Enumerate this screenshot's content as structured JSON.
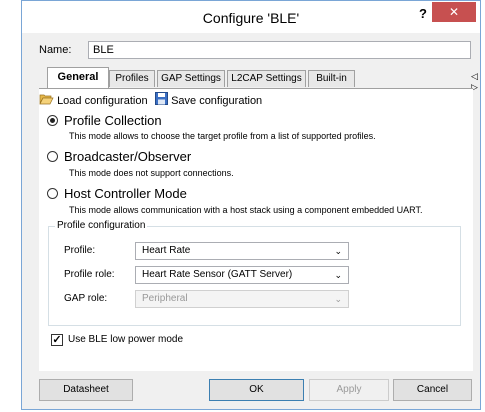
{
  "window": {
    "title": "Configure 'BLE'",
    "help_label": "?",
    "close_label": "✕"
  },
  "name": {
    "label": "Name:",
    "value": "BLE"
  },
  "tabs": [
    {
      "label": "General"
    },
    {
      "label": "Profiles"
    },
    {
      "label": "GAP Settings"
    },
    {
      "label": "L2CAP Settings"
    },
    {
      "label": "Built-in"
    }
  ],
  "tab_scroll": "◁ ▷",
  "toolbar": {
    "load_label": "Load configuration",
    "save_label": "Save configuration"
  },
  "modes": [
    {
      "title": "Profile Collection",
      "description": "This mode allows to choose the target profile from a list of supported profiles.",
      "selected": true
    },
    {
      "title": "Broadcaster/Observer",
      "description": "This mode does not support connections.",
      "selected": false
    },
    {
      "title": "Host Controller Mode",
      "description": "This mode allows communication with a host stack using a component embedded UART.",
      "selected": false
    }
  ],
  "profile_config": {
    "legend": "Profile configuration",
    "profile_label": "Profile:",
    "profile_value": "Heart Rate",
    "role_label": "Profile role:",
    "role_value": "Heart Rate Sensor (GATT Server)",
    "gap_label": "GAP role:",
    "gap_value": "Peripheral"
  },
  "low_power": {
    "label": "Use BLE low power mode",
    "checked": true
  },
  "buttons": {
    "datasheet": "Datasheet",
    "ok": "OK",
    "apply": "Apply",
    "cancel": "Cancel"
  }
}
